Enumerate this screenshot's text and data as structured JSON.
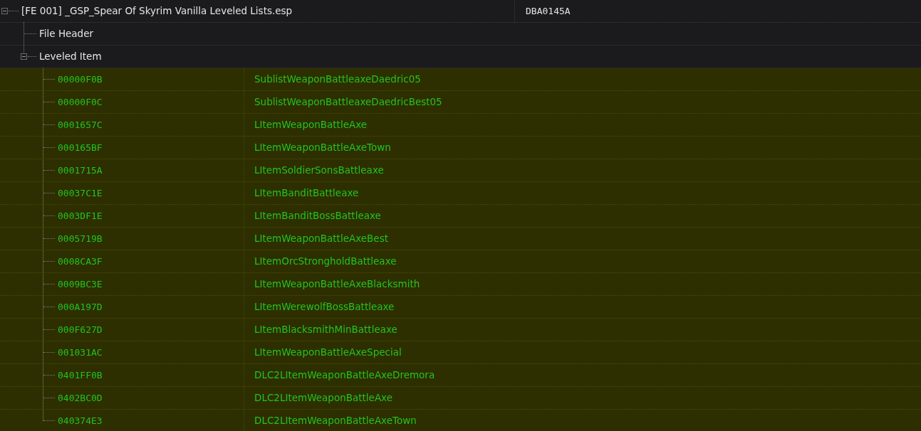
{
  "plugin": {
    "label": "[FE 001] _GSP_Spear Of Skyrim Vanilla Leveled Lists.esp",
    "form_id": "DBA0145A",
    "expanded": true,
    "children": [
      {
        "label": "File Header"
      },
      {
        "label": "Leveled Item",
        "expanded": true,
        "records": [
          {
            "form_id": "00000F0B",
            "editor_id": "SublistWeaponBattleaxeDaedric05"
          },
          {
            "form_id": "00000F0C",
            "editor_id": "SublistWeaponBattleaxeDaedricBest05"
          },
          {
            "form_id": "0001657C",
            "editor_id": "LItemWeaponBattleAxe"
          },
          {
            "form_id": "000165BF",
            "editor_id": "LItemWeaponBattleAxeTown"
          },
          {
            "form_id": "0001715A",
            "editor_id": "LItemSoldierSonsBattleaxe"
          },
          {
            "form_id": "00037C1E",
            "editor_id": "LItemBanditBattleaxe"
          },
          {
            "form_id": "0003DF1E",
            "editor_id": "LItemBanditBossBattleaxe"
          },
          {
            "form_id": "0005719B",
            "editor_id": "LItemWeaponBattleAxeBest"
          },
          {
            "form_id": "0008CA3F",
            "editor_id": "LItemOrcStrongholdBattleaxe"
          },
          {
            "form_id": "0009BC3E",
            "editor_id": "LItemWeaponBattleAxeBlacksmith"
          },
          {
            "form_id": "000A197D",
            "editor_id": "LItemWerewolfBossBattleaxe"
          },
          {
            "form_id": "000F627D",
            "editor_id": "LItemBlacksmithMinBattleaxe"
          },
          {
            "form_id": "001031AC",
            "editor_id": "LItemWeaponBattleAxeSpecial"
          },
          {
            "form_id": "0401FF0B",
            "editor_id": "DLC2LItemWeaponBattleAxeDremora"
          },
          {
            "form_id": "0402BC0D",
            "editor_id": "DLC2LItemWeaponBattleAxe"
          },
          {
            "form_id": "040374E3",
            "editor_id": "DLC2LItemWeaponBattleAxeTown"
          }
        ]
      }
    ]
  }
}
